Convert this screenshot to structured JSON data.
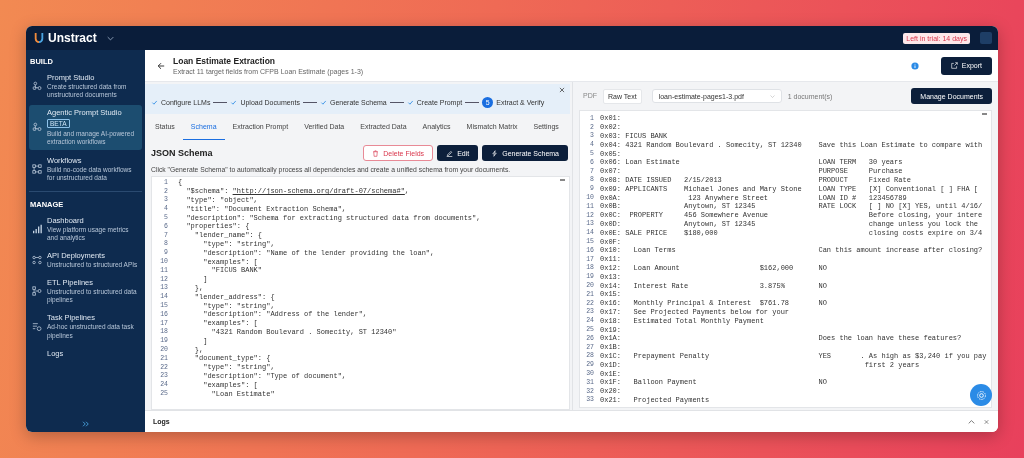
{
  "topbar": {
    "brand": "Unstract",
    "trial_badge": "Left in trial: 14 days"
  },
  "sidebar": {
    "sections": [
      {
        "heading": "BUILD",
        "items": [
          {
            "title": "Prompt Studio",
            "description": "Create structured data from unstructured documents",
            "selected": false
          },
          {
            "title": "Agentic Prompt Studio",
            "badge": "BETA",
            "description": "Build and manage AI-powered extraction workflows",
            "selected": true
          },
          {
            "title": "Workflows",
            "description": "Build no-code data workflows for unstructured data",
            "selected": false
          }
        ]
      },
      {
        "heading": "MANAGE",
        "items": [
          {
            "title": "Dashboard",
            "description": "View platform usage metrics and analytics",
            "selected": false
          },
          {
            "title": "API Deployments",
            "description": "Unstructured to structured APIs",
            "selected": false
          },
          {
            "title": "ETL Pipelines",
            "description": "Unstructured to structured data pipelines",
            "selected": false
          },
          {
            "title": "Task Pipelines",
            "description": "Ad-hoc unstructured data task pipelines",
            "selected": false
          },
          {
            "title": "Logs",
            "selected": false
          }
        ]
      }
    ]
  },
  "header": {
    "title": "Loan Estimate Extraction",
    "subtitle": "Extract 11 target fields from CFPB Loan Estimate (pages 1-3)",
    "export_label": "Export"
  },
  "stepper": {
    "steps": [
      {
        "label": "Configure LLMs",
        "done": true
      },
      {
        "label": "Upload Documents",
        "done": true
      },
      {
        "label": "Generate Schema",
        "done": true
      },
      {
        "label": "Create Prompt",
        "done": true
      },
      {
        "label": "Extract & Verify",
        "done": false,
        "number": "5"
      }
    ]
  },
  "tabs": [
    {
      "label": "Status",
      "selected": false
    },
    {
      "label": "Schema",
      "selected": true
    },
    {
      "label": "Extraction Prompt",
      "selected": false
    },
    {
      "label": "Verified Data",
      "selected": false
    },
    {
      "label": "Extracted Data",
      "selected": false
    },
    {
      "label": "Analytics",
      "selected": false
    },
    {
      "label": "Mismatch Matrix",
      "selected": false
    },
    {
      "label": "Settings",
      "selected": false
    }
  ],
  "schema": {
    "heading": "JSON Schema",
    "buttons": [
      {
        "label": "Delete Fields",
        "kind": "danger"
      },
      {
        "label": "Edit",
        "kind": "edit"
      },
      {
        "label": "Generate Schema",
        "kind": "generate"
      }
    ],
    "hint": "Click \"Generate Schema\" to automatically process all dependencies and create a unified schema from your documents.",
    "lines": [
      {
        "n": "1",
        "code": "{"
      },
      {
        "n": "2",
        "code": "  \"$schema\": ",
        "link": "\"http://json-schema.org/draft-07/schema#\"",
        "after": ","
      },
      {
        "n": "3",
        "code": "  \"type\": \"object\","
      },
      {
        "n": "4",
        "code": "  \"title\": \"Document Extraction Schema\","
      },
      {
        "n": "5",
        "code": "  \"description\": \"Schema for extracting structured data from documents\","
      },
      {
        "n": "6",
        "code": "  \"properties\": {"
      },
      {
        "n": "7",
        "code": "    \"lender_name\": {"
      },
      {
        "n": "8",
        "code": "      \"type\": \"string\","
      },
      {
        "n": "9",
        "code": "      \"description\": \"Name of the lender providing the loan\","
      },
      {
        "n": "10",
        "code": "      \"examples\": ["
      },
      {
        "n": "11",
        "code": "        \"FICUS BANK\""
      },
      {
        "n": "12",
        "code": "      ]"
      },
      {
        "n": "13",
        "code": "    },"
      },
      {
        "n": "14",
        "code": "    \"lender_address\": {"
      },
      {
        "n": "15",
        "code": "      \"type\": \"string\","
      },
      {
        "n": "16",
        "code": "      \"description\": \"Address of the lender\","
      },
      {
        "n": "17",
        "code": "      \"examples\": ["
      },
      {
        "n": "18",
        "code": "        \"4321 Random Boulevard . Somecity, ST 12340\""
      },
      {
        "n": "19",
        "code": "      ]"
      },
      {
        "n": "20",
        "code": "    },"
      },
      {
        "n": "21",
        "code": "    \"document_type\": {"
      },
      {
        "n": "22",
        "code": "      \"type\": \"string\","
      },
      {
        "n": "23",
        "code": "      \"description\": \"Type of document\","
      },
      {
        "n": "24",
        "code": "      \"examples\": ["
      },
      {
        "n": "25",
        "code": "        \"Loan Estimate\""
      }
    ]
  },
  "document": {
    "view_toggle": [
      {
        "label": "PDF",
        "selected": false
      },
      {
        "label": "Raw Text",
        "selected": true
      }
    ],
    "file_select": "loan-estimate-pages1-3.pdf",
    "doc_count": "1 document(s)",
    "manage_label": "Manage Documents",
    "lines": [
      {
        "n": "1",
        "text": "0x01:"
      },
      {
        "n": "2",
        "text": "0x02:"
      },
      {
        "n": "3",
        "text": "0x03: FICUS BANK"
      },
      {
        "n": "4",
        "text": "0x04: 4321 Random Boulevard . Somecity, ST 12340    Save this Loan Estimate to compare with"
      },
      {
        "n": "5",
        "text": "0x05:"
      },
      {
        "n": "6",
        "text": "0x06: Loan Estimate                                 LOAN TERM   30 years"
      },
      {
        "n": "7",
        "text": "0x07:                                               PURPOSE     Purchase"
      },
      {
        "n": "8",
        "text": "0x08: DATE ISSUED   2/15/2013                       PRODUCT     Fixed Rate"
      },
      {
        "n": "9",
        "text": "0x09: APPLICANTS    Michael Jones and Mary Stone    LOAN TYPE   [X] Conventional [ ] FHA ["
      },
      {
        "n": "10",
        "text": "0x0A:                123 Anywhere Street            LOAN ID #   123456789"
      },
      {
        "n": "11",
        "text": "0x0B:               Anytown, ST 12345               RATE LOCK   [ ] NO [X] YES, until 4/16/"
      },
      {
        "n": "12",
        "text": "0x0C:  PROPERTY     456 Somewhere Avenue                        Before closing, your intere"
      },
      {
        "n": "13",
        "text": "0x0D:               Anytown, ST 12345                           change unless you lock the"
      },
      {
        "n": "14",
        "text": "0x0E: SALE PRICE    $180,000                                    closing costs expire on 3/4"
      },
      {
        "n": "15",
        "text": "0x0F:"
      },
      {
        "n": "16",
        "text": "0x10:   Loan Terms                                  Can this amount increase after closing?"
      },
      {
        "n": "17",
        "text": "0x11:"
      },
      {
        "n": "18",
        "text": "0x12:   Loan Amount                   $162,000      NO"
      },
      {
        "n": "19",
        "text": "0x13:"
      },
      {
        "n": "20",
        "text": "0x14:   Interest Rate                 3.875%        NO"
      },
      {
        "n": "21",
        "text": "0x15:"
      },
      {
        "n": "22",
        "text": "0x16:   Monthly Principal & Interest  $761.78       NO"
      },
      {
        "n": "23",
        "text": "0x17:   See Projected Payments below for your"
      },
      {
        "n": "24",
        "text": "0x18:   Estimated Total Monthly Payment"
      },
      {
        "n": "25",
        "text": "0x19:"
      },
      {
        "n": "26",
        "text": "0x1A:                                               Does the loan have these features?"
      },
      {
        "n": "27",
        "text": "0x1B:"
      },
      {
        "n": "28",
        "text": "0x1C:   Prepayment Penalty                          YES       . As high as $3,240 if you pay"
      },
      {
        "n": "29",
        "text": "0x1D:                                                          first 2 years"
      },
      {
        "n": "30",
        "text": "0x1E:"
      },
      {
        "n": "31",
        "text": "0x1F:   Balloon Payment                             NO"
      },
      {
        "n": "32",
        "text": "0x20:"
      },
      {
        "n": "33",
        "text": "0x21:   Projected Payments"
      }
    ]
  },
  "logs": {
    "title": "Logs"
  }
}
